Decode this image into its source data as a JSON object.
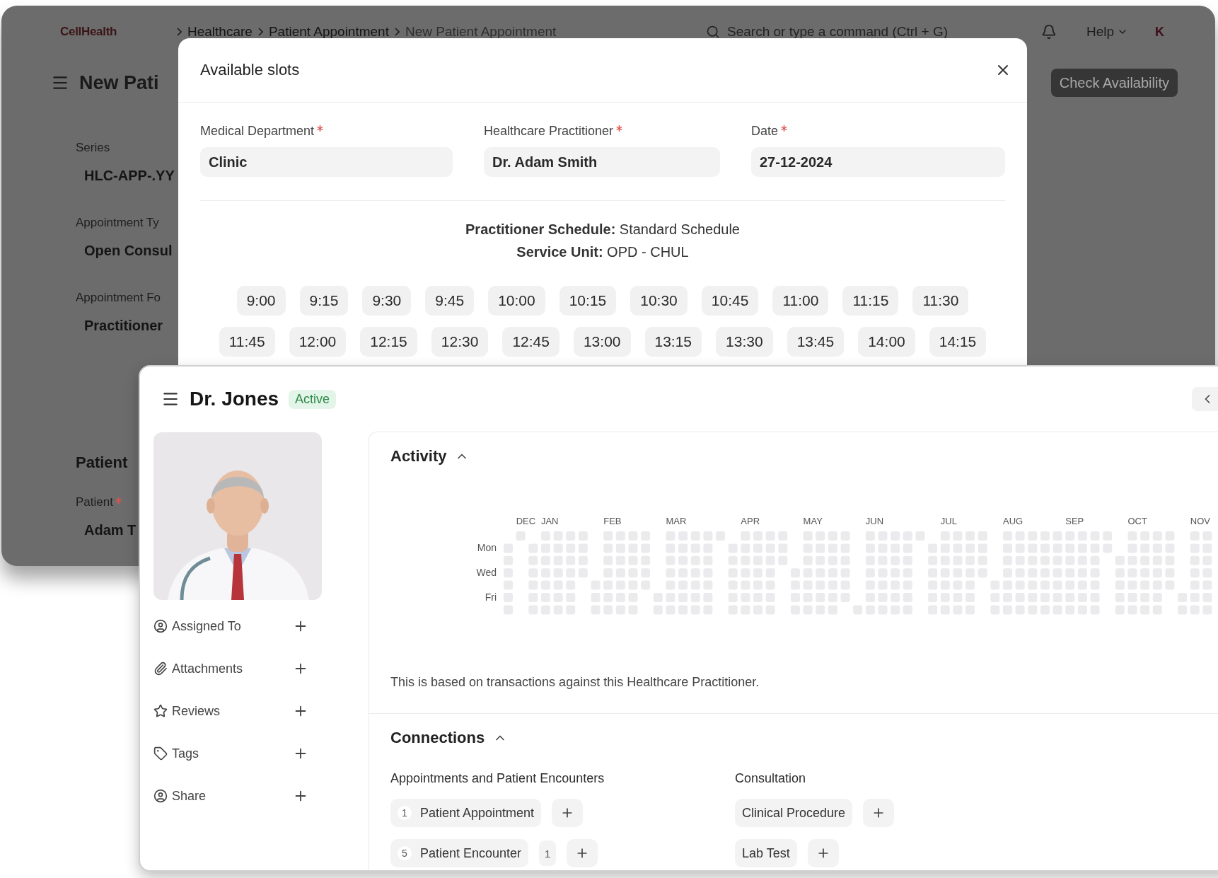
{
  "background_page": {
    "logo": "CellHealth",
    "breadcrumbs": [
      {
        "label": "Healthcare",
        "current": false
      },
      {
        "label": "Patient Appointment",
        "current": false
      },
      {
        "label": "New Patient Appointment",
        "current": true
      }
    ],
    "search": {
      "placeholder": "Search or type a command (Ctrl + G)"
    },
    "help": "Help",
    "avatar": "K",
    "title": "New Pati",
    "primary_button": "Check Availability",
    "fields": [
      {
        "label": "Series",
        "value": "HLC-APP-.YY",
        "required": false
      },
      {
        "label": "Appointment Ty",
        "value": "Open Consul",
        "required": false
      },
      {
        "label": "Appointment Fo",
        "value": "Practitioner",
        "required": false
      }
    ],
    "section": {
      "title": "Patient",
      "fields": [
        {
          "label": "Patient",
          "value": "Adam T",
          "required": true
        }
      ]
    }
  },
  "modal": {
    "title": "Available slots",
    "fields": [
      {
        "label": "Medical Department",
        "value": "Clinic",
        "required": true
      },
      {
        "label": "Healthcare Practitioner",
        "value": "Dr. Adam Smith",
        "required": true
      },
      {
        "label": "Date",
        "value": "27-12-2024",
        "required": true
      }
    ],
    "schedule": [
      "**Practitioner Schedule:** Standard Schedule",
      "**Service Unit:** OPD - CHUL"
    ],
    "slot_rows": [
      [
        "9:00",
        "9:15",
        "9:30",
        "9:45",
        "10:00",
        "10:15",
        "10:30",
        "10:45",
        "11:00",
        "11:15",
        "11:30"
      ],
      [
        "11:45",
        "12:00",
        "12:15",
        "12:30",
        "12:45",
        "13:00",
        "13:15",
        "13:30",
        "13:45",
        "14:00",
        "14:15"
      ]
    ]
  },
  "practitioner": {
    "name": "Dr. Jones",
    "status": "Active",
    "sidebar": [
      {
        "label": "Assigned To"
      },
      {
        "label": "Attachments"
      },
      {
        "label": "Reviews"
      },
      {
        "label": "Tags"
      },
      {
        "label": "Share"
      }
    ],
    "activity": {
      "title": "Activity",
      "expanded": true,
      "months": [
        "DEC",
        "JAN",
        "FEB",
        "MAR",
        "APR",
        "MAY",
        "JUN",
        "JUL",
        "AUG",
        "SEP",
        "OCT",
        "NOV"
      ],
      "weekdays": [
        "Mon",
        "Wed",
        "Fri"
      ],
      "note": "This is based on transactions against this Healthcare Practitioner."
    },
    "connections": {
      "title": "Connections",
      "expanded": true,
      "groups": [
        {
          "title": "Appointments and Patient Encounters",
          "items": [
            {
              "label": "Patient Appointment",
              "count": "1"
            },
            {
              "label": "Patient Encounter",
              "count": "5",
              "open_count": "1"
            }
          ]
        },
        {
          "title": "Consultation",
          "items": [
            {
              "label": "Clinical Procedure"
            },
            {
              "label": "Lab Test"
            }
          ]
        }
      ]
    }
  }
}
